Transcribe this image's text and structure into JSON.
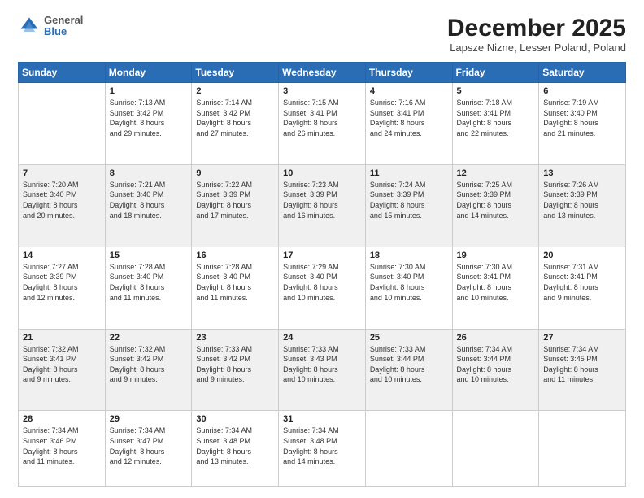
{
  "logo": {
    "general": "General",
    "blue": "Blue"
  },
  "header": {
    "month": "December 2025",
    "location": "Lapsze Nizne, Lesser Poland, Poland"
  },
  "weekdays": [
    "Sunday",
    "Monday",
    "Tuesday",
    "Wednesday",
    "Thursday",
    "Friday",
    "Saturday"
  ],
  "weeks": [
    [
      {
        "day": "",
        "sunrise": "",
        "sunset": "",
        "daylight": ""
      },
      {
        "day": "1",
        "sunrise": "Sunrise: 7:13 AM",
        "sunset": "Sunset: 3:42 PM",
        "daylight": "Daylight: 8 hours and 29 minutes."
      },
      {
        "day": "2",
        "sunrise": "Sunrise: 7:14 AM",
        "sunset": "Sunset: 3:42 PM",
        "daylight": "Daylight: 8 hours and 27 minutes."
      },
      {
        "day": "3",
        "sunrise": "Sunrise: 7:15 AM",
        "sunset": "Sunset: 3:41 PM",
        "daylight": "Daylight: 8 hours and 26 minutes."
      },
      {
        "day": "4",
        "sunrise": "Sunrise: 7:16 AM",
        "sunset": "Sunset: 3:41 PM",
        "daylight": "Daylight: 8 hours and 24 minutes."
      },
      {
        "day": "5",
        "sunrise": "Sunrise: 7:18 AM",
        "sunset": "Sunset: 3:41 PM",
        "daylight": "Daylight: 8 hours and 22 minutes."
      },
      {
        "day": "6",
        "sunrise": "Sunrise: 7:19 AM",
        "sunset": "Sunset: 3:40 PM",
        "daylight": "Daylight: 8 hours and 21 minutes."
      }
    ],
    [
      {
        "day": "7",
        "sunrise": "Sunrise: 7:20 AM",
        "sunset": "Sunset: 3:40 PM",
        "daylight": "Daylight: 8 hours and 20 minutes."
      },
      {
        "day": "8",
        "sunrise": "Sunrise: 7:21 AM",
        "sunset": "Sunset: 3:40 PM",
        "daylight": "Daylight: 8 hours and 18 minutes."
      },
      {
        "day": "9",
        "sunrise": "Sunrise: 7:22 AM",
        "sunset": "Sunset: 3:39 PM",
        "daylight": "Daylight: 8 hours and 17 minutes."
      },
      {
        "day": "10",
        "sunrise": "Sunrise: 7:23 AM",
        "sunset": "Sunset: 3:39 PM",
        "daylight": "Daylight: 8 hours and 16 minutes."
      },
      {
        "day": "11",
        "sunrise": "Sunrise: 7:24 AM",
        "sunset": "Sunset: 3:39 PM",
        "daylight": "Daylight: 8 hours and 15 minutes."
      },
      {
        "day": "12",
        "sunrise": "Sunrise: 7:25 AM",
        "sunset": "Sunset: 3:39 PM",
        "daylight": "Daylight: 8 hours and 14 minutes."
      },
      {
        "day": "13",
        "sunrise": "Sunrise: 7:26 AM",
        "sunset": "Sunset: 3:39 PM",
        "daylight": "Daylight: 8 hours and 13 minutes."
      }
    ],
    [
      {
        "day": "14",
        "sunrise": "Sunrise: 7:27 AM",
        "sunset": "Sunset: 3:39 PM",
        "daylight": "Daylight: 8 hours and 12 minutes."
      },
      {
        "day": "15",
        "sunrise": "Sunrise: 7:28 AM",
        "sunset": "Sunset: 3:40 PM",
        "daylight": "Daylight: 8 hours and 11 minutes."
      },
      {
        "day": "16",
        "sunrise": "Sunrise: 7:28 AM",
        "sunset": "Sunset: 3:40 PM",
        "daylight": "Daylight: 8 hours and 11 minutes."
      },
      {
        "day": "17",
        "sunrise": "Sunrise: 7:29 AM",
        "sunset": "Sunset: 3:40 PM",
        "daylight": "Daylight: 8 hours and 10 minutes."
      },
      {
        "day": "18",
        "sunrise": "Sunrise: 7:30 AM",
        "sunset": "Sunset: 3:40 PM",
        "daylight": "Daylight: 8 hours and 10 minutes."
      },
      {
        "day": "19",
        "sunrise": "Sunrise: 7:30 AM",
        "sunset": "Sunset: 3:41 PM",
        "daylight": "Daylight: 8 hours and 10 minutes."
      },
      {
        "day": "20",
        "sunrise": "Sunrise: 7:31 AM",
        "sunset": "Sunset: 3:41 PM",
        "daylight": "Daylight: 8 hours and 9 minutes."
      }
    ],
    [
      {
        "day": "21",
        "sunrise": "Sunrise: 7:32 AM",
        "sunset": "Sunset: 3:41 PM",
        "daylight": "Daylight: 8 hours and 9 minutes."
      },
      {
        "day": "22",
        "sunrise": "Sunrise: 7:32 AM",
        "sunset": "Sunset: 3:42 PM",
        "daylight": "Daylight: 8 hours and 9 minutes."
      },
      {
        "day": "23",
        "sunrise": "Sunrise: 7:33 AM",
        "sunset": "Sunset: 3:42 PM",
        "daylight": "Daylight: 8 hours and 9 minutes."
      },
      {
        "day": "24",
        "sunrise": "Sunrise: 7:33 AM",
        "sunset": "Sunset: 3:43 PM",
        "daylight": "Daylight: 8 hours and 10 minutes."
      },
      {
        "day": "25",
        "sunrise": "Sunrise: 7:33 AM",
        "sunset": "Sunset: 3:44 PM",
        "daylight": "Daylight: 8 hours and 10 minutes."
      },
      {
        "day": "26",
        "sunrise": "Sunrise: 7:34 AM",
        "sunset": "Sunset: 3:44 PM",
        "daylight": "Daylight: 8 hours and 10 minutes."
      },
      {
        "day": "27",
        "sunrise": "Sunrise: 7:34 AM",
        "sunset": "Sunset: 3:45 PM",
        "daylight": "Daylight: 8 hours and 11 minutes."
      }
    ],
    [
      {
        "day": "28",
        "sunrise": "Sunrise: 7:34 AM",
        "sunset": "Sunset: 3:46 PM",
        "daylight": "Daylight: 8 hours and 11 minutes."
      },
      {
        "day": "29",
        "sunrise": "Sunrise: 7:34 AM",
        "sunset": "Sunset: 3:47 PM",
        "daylight": "Daylight: 8 hours and 12 minutes."
      },
      {
        "day": "30",
        "sunrise": "Sunrise: 7:34 AM",
        "sunset": "Sunset: 3:48 PM",
        "daylight": "Daylight: 8 hours and 13 minutes."
      },
      {
        "day": "31",
        "sunrise": "Sunrise: 7:34 AM",
        "sunset": "Sunset: 3:48 PM",
        "daylight": "Daylight: 8 hours and 14 minutes."
      },
      {
        "day": "",
        "sunrise": "",
        "sunset": "",
        "daylight": ""
      },
      {
        "day": "",
        "sunrise": "",
        "sunset": "",
        "daylight": ""
      },
      {
        "day": "",
        "sunrise": "",
        "sunset": "",
        "daylight": ""
      }
    ]
  ]
}
